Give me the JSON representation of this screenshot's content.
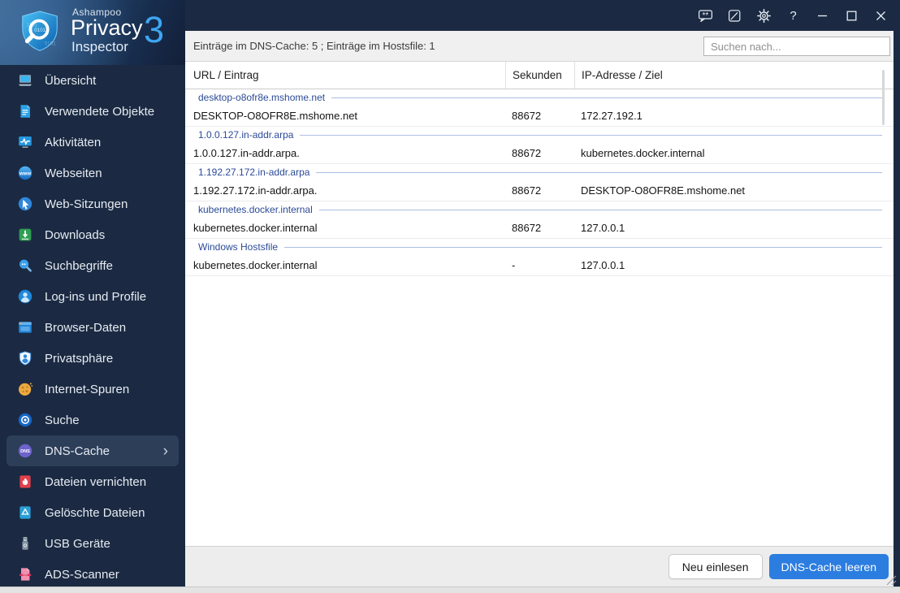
{
  "logo": {
    "brand": "Ashampoo",
    "product_line1": "Privacy",
    "product_line2": "Inspector",
    "version": "3"
  },
  "titlebar": {
    "icons": [
      {
        "id": "feedback",
        "name": "feedback-bubble-icon"
      },
      {
        "id": "notes",
        "name": "notes-icon"
      },
      {
        "id": "settings",
        "name": "settings-gear-icon"
      },
      {
        "id": "help",
        "name": "help-icon"
      },
      {
        "id": "minimize",
        "name": "minimize-icon"
      },
      {
        "id": "maximize",
        "name": "maximize-icon"
      },
      {
        "id": "close",
        "name": "close-icon"
      }
    ]
  },
  "infobar": {
    "status": "Einträge im DNS-Cache: 5 ; Einträge im Hostsfile: 1",
    "search_placeholder": "Suchen nach..."
  },
  "sidebar": {
    "selected_index": 12,
    "items": [
      {
        "id": "uebersicht",
        "icon": "monitor-icon",
        "label": "Übersicht"
      },
      {
        "id": "verwendete-objekte",
        "icon": "document-icon",
        "label": "Verwendete Objekte"
      },
      {
        "id": "aktivitaeten",
        "icon": "activity-monitor-icon",
        "label": "Aktivitäten"
      },
      {
        "id": "webseiten",
        "icon": "globe-www-icon",
        "label": "Webseiten"
      },
      {
        "id": "web-sitzungen",
        "icon": "globe-cursor-icon",
        "label": "Web-Sitzungen"
      },
      {
        "id": "downloads",
        "icon": "download-icon",
        "label": "Downloads"
      },
      {
        "id": "suchbegriffe",
        "icon": "magnifier-dots-icon",
        "label": "Suchbegriffe"
      },
      {
        "id": "logins",
        "icon": "user-icon",
        "label": "Log-ins und Profile"
      },
      {
        "id": "browser-daten",
        "icon": "browser-window-icon",
        "label": "Browser-Daten"
      },
      {
        "id": "privatsphaere",
        "icon": "shield-user-icon",
        "label": "Privatsphäre"
      },
      {
        "id": "internet-spuren",
        "icon": "cookie-icon",
        "label": "Internet-Spuren"
      },
      {
        "id": "suche",
        "icon": "eye-target-icon",
        "label": "Suche"
      },
      {
        "id": "dns-cache",
        "icon": "dns-badge-icon",
        "label": "DNS-Cache"
      },
      {
        "id": "dateien-vernichten",
        "icon": "shredder-flame-icon",
        "label": "Dateien vernichten"
      },
      {
        "id": "geloeschte-dateien",
        "icon": "recycle-bin-icon",
        "label": "Gelöschte Dateien"
      },
      {
        "id": "usb-geraete",
        "icon": "usb-stick-icon",
        "label": "USB Geräte"
      },
      {
        "id": "ads-scanner",
        "icon": "ads-document-icon",
        "label": "ADS-Scanner"
      }
    ]
  },
  "table": {
    "columns": [
      "URL / Eintrag",
      "Sekunden",
      "IP-Adresse / Ziel"
    ],
    "groups": [
      {
        "group": "desktop-o8ofr8e.mshome.net",
        "rows": [
          [
            "DESKTOP-O8OFR8E.mshome.net",
            "88672",
            "172.27.192.1"
          ]
        ]
      },
      {
        "group": "1.0.0.127.in-addr.arpa",
        "rows": [
          [
            "1.0.0.127.in-addr.arpa.",
            "88672",
            "kubernetes.docker.internal"
          ]
        ]
      },
      {
        "group": "1.192.27.172.in-addr.arpa",
        "rows": [
          [
            "1.192.27.172.in-addr.arpa.",
            "88672",
            "DESKTOP-O8OFR8E.mshome.net"
          ]
        ]
      },
      {
        "group": "kubernetes.docker.internal",
        "rows": [
          [
            "kubernetes.docker.internal",
            "88672",
            "127.0.0.1"
          ]
        ]
      },
      {
        "group": "Windows Hostsfile",
        "rows": [
          [
            "kubernetes.docker.internal",
            "-",
            "127.0.0.1"
          ]
        ]
      }
    ]
  },
  "footer": {
    "buttons": [
      {
        "label": "Neu einlesen",
        "type": "secondary"
      },
      {
        "label": "DNS-Cache leeren",
        "type": "primary"
      }
    ]
  },
  "colors": {
    "accent_blue": "#2b7de0",
    "sidebar_bg": "#1b2a42",
    "selected_item_bg": "#2d3e59",
    "group_text_blue": "#2b4a97",
    "group_line_blue": "#aebfe0",
    "logo_version_blue": "#3ea6f2"
  }
}
